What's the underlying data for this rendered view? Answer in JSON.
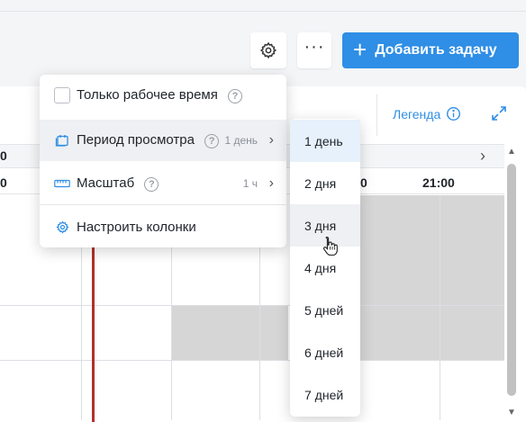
{
  "toolbar": {
    "settings_icon": "gear-icon",
    "more_label": "···",
    "add_task_label": "Добавить задачу",
    "add_task_icon": "plus-icon",
    "accent_color": "#2f8ee5"
  },
  "timeline": {
    "legend_label": "Легенда",
    "legend_icon": "info-icon",
    "expand_icon": "expand-icon",
    "date_partial": "0",
    "hour_partial_left": "0",
    "hour_partial_mid": "0",
    "hour_2100": "21:00",
    "now_line_color": "#b3312b"
  },
  "menu": {
    "items": [
      {
        "label": "Только рабочее время",
        "value": "",
        "type": "checkbox",
        "checked": false
      },
      {
        "label": "Период просмотра",
        "value": "1 день",
        "type": "submenu",
        "icon": "calendar-icon"
      },
      {
        "label": "Масштаб",
        "value": "1 ч",
        "type": "submenu",
        "icon": "ruler-icon"
      },
      {
        "label": "Настроить колонки",
        "value": "",
        "type": "action",
        "icon": "gear-icon"
      }
    ]
  },
  "submenu": {
    "items": [
      {
        "label": "1 день",
        "selected": true
      },
      {
        "label": "2 дня",
        "selected": false
      },
      {
        "label": "3 дня",
        "selected": false,
        "hover": true
      },
      {
        "label": "4 дня",
        "selected": false
      },
      {
        "label": "5 дней",
        "selected": false
      },
      {
        "label": "6 дней",
        "selected": false
      },
      {
        "label": "7 дней",
        "selected": false
      }
    ]
  }
}
